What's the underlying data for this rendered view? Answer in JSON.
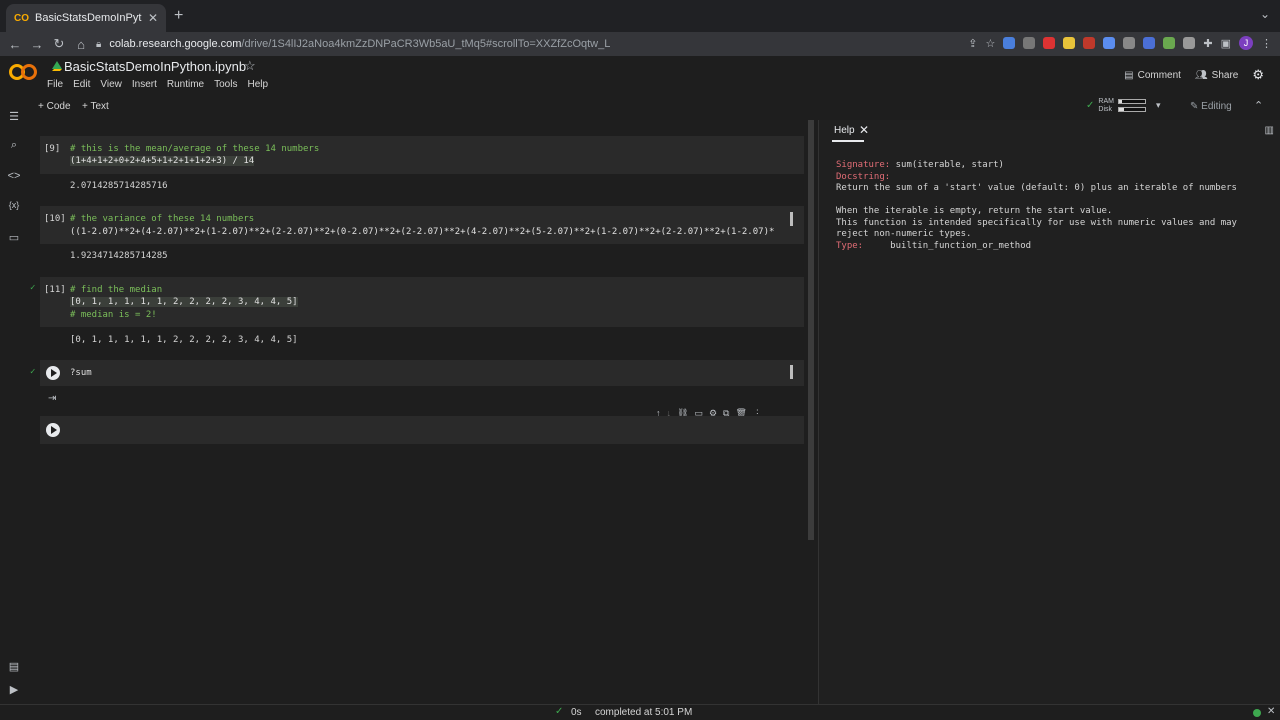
{
  "browser": {
    "tab_title": "BasicStatsDemoInPython.ipynb",
    "tab_favicon": "CO",
    "url_host": "colab.research.google.com",
    "url_path": "/drive/1S4lIJ2aNoa4kmZzDNPaCR3Wb5aU_tMq5#scrollTo=XXZfZcOqtw_L",
    "profile_initial": "J"
  },
  "colab": {
    "notebook_title": "BasicStatsDemoInPython.ipynb",
    "menu": [
      "File",
      "Edit",
      "View",
      "Insert",
      "Runtime",
      "Tools",
      "Help"
    ],
    "comment_label": "Comment",
    "share_label": "Share",
    "toolbar": {
      "add_code": "+ Code",
      "add_text": "+ Text",
      "ram_label": "RAM",
      "disk_label": "Disk",
      "ram_usage": 0.1,
      "disk_usage": 0.2,
      "editing_label": "Editing"
    }
  },
  "cells": [
    {
      "prompt": "[9]",
      "lines": [
        "# this is the mean/average of these 14 numbers",
        "(1+4+1+2+0+2+4+5+1+2+1+1+2+3) / 14"
      ],
      "output": "2.0714285714285716"
    },
    {
      "prompt": "[10]",
      "lines": [
        "# the variance of these 14 numbers",
        "((1-2.07)**2+(4-2.07)**2+(1-2.07)**2+(2-2.07)**2+(0-2.07)**2+(2-2.07)**2+(4-2.07)**2+(5-2.07)**2+(1-2.07)**2+(2-2.07)**2+(1-2.07)*"
      ],
      "output": "1.9234714285714285"
    },
    {
      "prompt": "[11]",
      "lines": [
        "# find the median",
        "[0, 1, 1, 1, 1, 1, 2, 2, 2, 2, 3, 4, 4, 5]",
        "# median is = 2!"
      ],
      "output": "[0, 1, 1, 1, 1, 1, 2, 2, 2, 2, 3, 4, 4, 5]"
    },
    {
      "prompt": "",
      "lines": [
        "?sum"
      ],
      "output": ""
    }
  ],
  "help": {
    "tab_label": "Help",
    "rows": [
      {
        "key": "Signature:",
        "value": "sum(iterable, start)"
      },
      {
        "key": "Docstring:",
        "value": ""
      },
      {
        "key": "",
        "value": "Return the sum of a 'start' value (default: 0) plus an iterable of numbers"
      },
      {
        "key": "",
        "value": ""
      },
      {
        "key": "",
        "value": "When the iterable is empty, return the start value."
      },
      {
        "key": "",
        "value": "This function is intended specifically for use with numeric values and may"
      },
      {
        "key": "",
        "value": "reject non-numeric types."
      },
      {
        "key": "Type:",
        "value": "     builtin_function_or_method"
      }
    ]
  },
  "status": {
    "time": "0s",
    "message": "completed at 5:01 PM"
  }
}
